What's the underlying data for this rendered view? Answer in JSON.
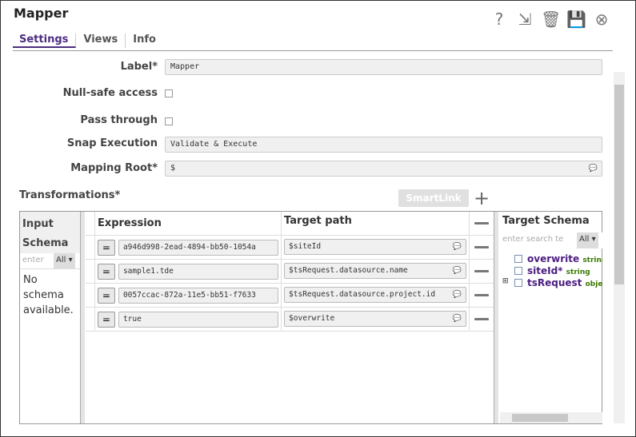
{
  "title": "Mapper",
  "toolbar_icons": [
    "help-icon",
    "export-icon",
    "trash-icon",
    "save-icon",
    "close-icon"
  ],
  "tabs": [
    "Settings",
    "Views",
    "Info"
  ],
  "fields": {
    "label": {
      "label": "Label*",
      "value": "Mapper"
    },
    "null_safe": {
      "label": "Null-safe access",
      "checked": false
    },
    "pass_through": {
      "label": "Pass through",
      "checked": false
    },
    "snap_execution": {
      "label": "Snap Execution",
      "value": "Validate & Execute"
    },
    "mapping_root": {
      "label": "Mapping Root*",
      "value": "$"
    }
  },
  "transformations": {
    "label": "Transformations*",
    "smartlink": "SmartLink",
    "input_schema": {
      "title_1": "Input",
      "title_2": "Schema",
      "search_placeholder": "enter",
      "filter": "All",
      "empty": "No schema available."
    },
    "headers": {
      "expression": "Expression",
      "target": "Target path"
    },
    "rows": [
      {
        "expr": "a946d998-2ead-4894-bb50-1054a",
        "target": "$siteId"
      },
      {
        "expr": "sample1.tde",
        "target": "$tsRequest.datasource.name"
      },
      {
        "expr": "0057ccac-872a-11e5-bb51-f7633",
        "target": "$tsRequest.datasource.project.id"
      },
      {
        "expr": "true",
        "target": "$overwrite"
      }
    ],
    "target_schema": {
      "title": "Target Schema",
      "search_placeholder": "enter search te",
      "filter": "All",
      "items": [
        {
          "name": "overwrite",
          "type": "string"
        },
        {
          "name": "siteId*",
          "type": "string"
        },
        {
          "name": "tsRequest",
          "type": "object"
        }
      ]
    }
  }
}
